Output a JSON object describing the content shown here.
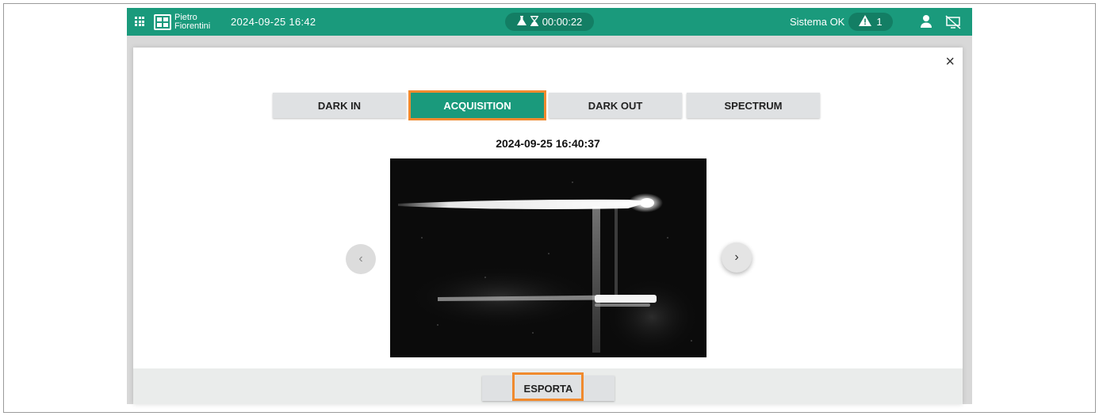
{
  "topbar": {
    "logo_line1": "Pietro",
    "logo_line2": "Fiorentini",
    "datetime": "2024-09-25 16:42",
    "timer": "00:00:22",
    "status": "Sistema OK",
    "alert_count": "1",
    "apps_icon": "grid-icon",
    "timer_icons": [
      "flask-icon",
      "hourglass-icon"
    ],
    "alert_icon": "warning-icon",
    "user_icon": "user-icon",
    "screen_icon": "screen-off-icon"
  },
  "dialog": {
    "close_label": "×",
    "tabs": [
      {
        "label": "DARK IN",
        "active": false
      },
      {
        "label": "ACQUISITION",
        "active": true
      },
      {
        "label": "DARK OUT",
        "active": false
      },
      {
        "label": "SPECTRUM",
        "active": false
      }
    ],
    "capture_time": "2024-09-25 16:40:37",
    "prev_label": "‹",
    "next_label": "›",
    "export_label": "ESPORTA"
  },
  "colors": {
    "brand_green": "#1a9a7c",
    "dark_green": "#137e64",
    "highlight_orange": "#f08a2e"
  }
}
